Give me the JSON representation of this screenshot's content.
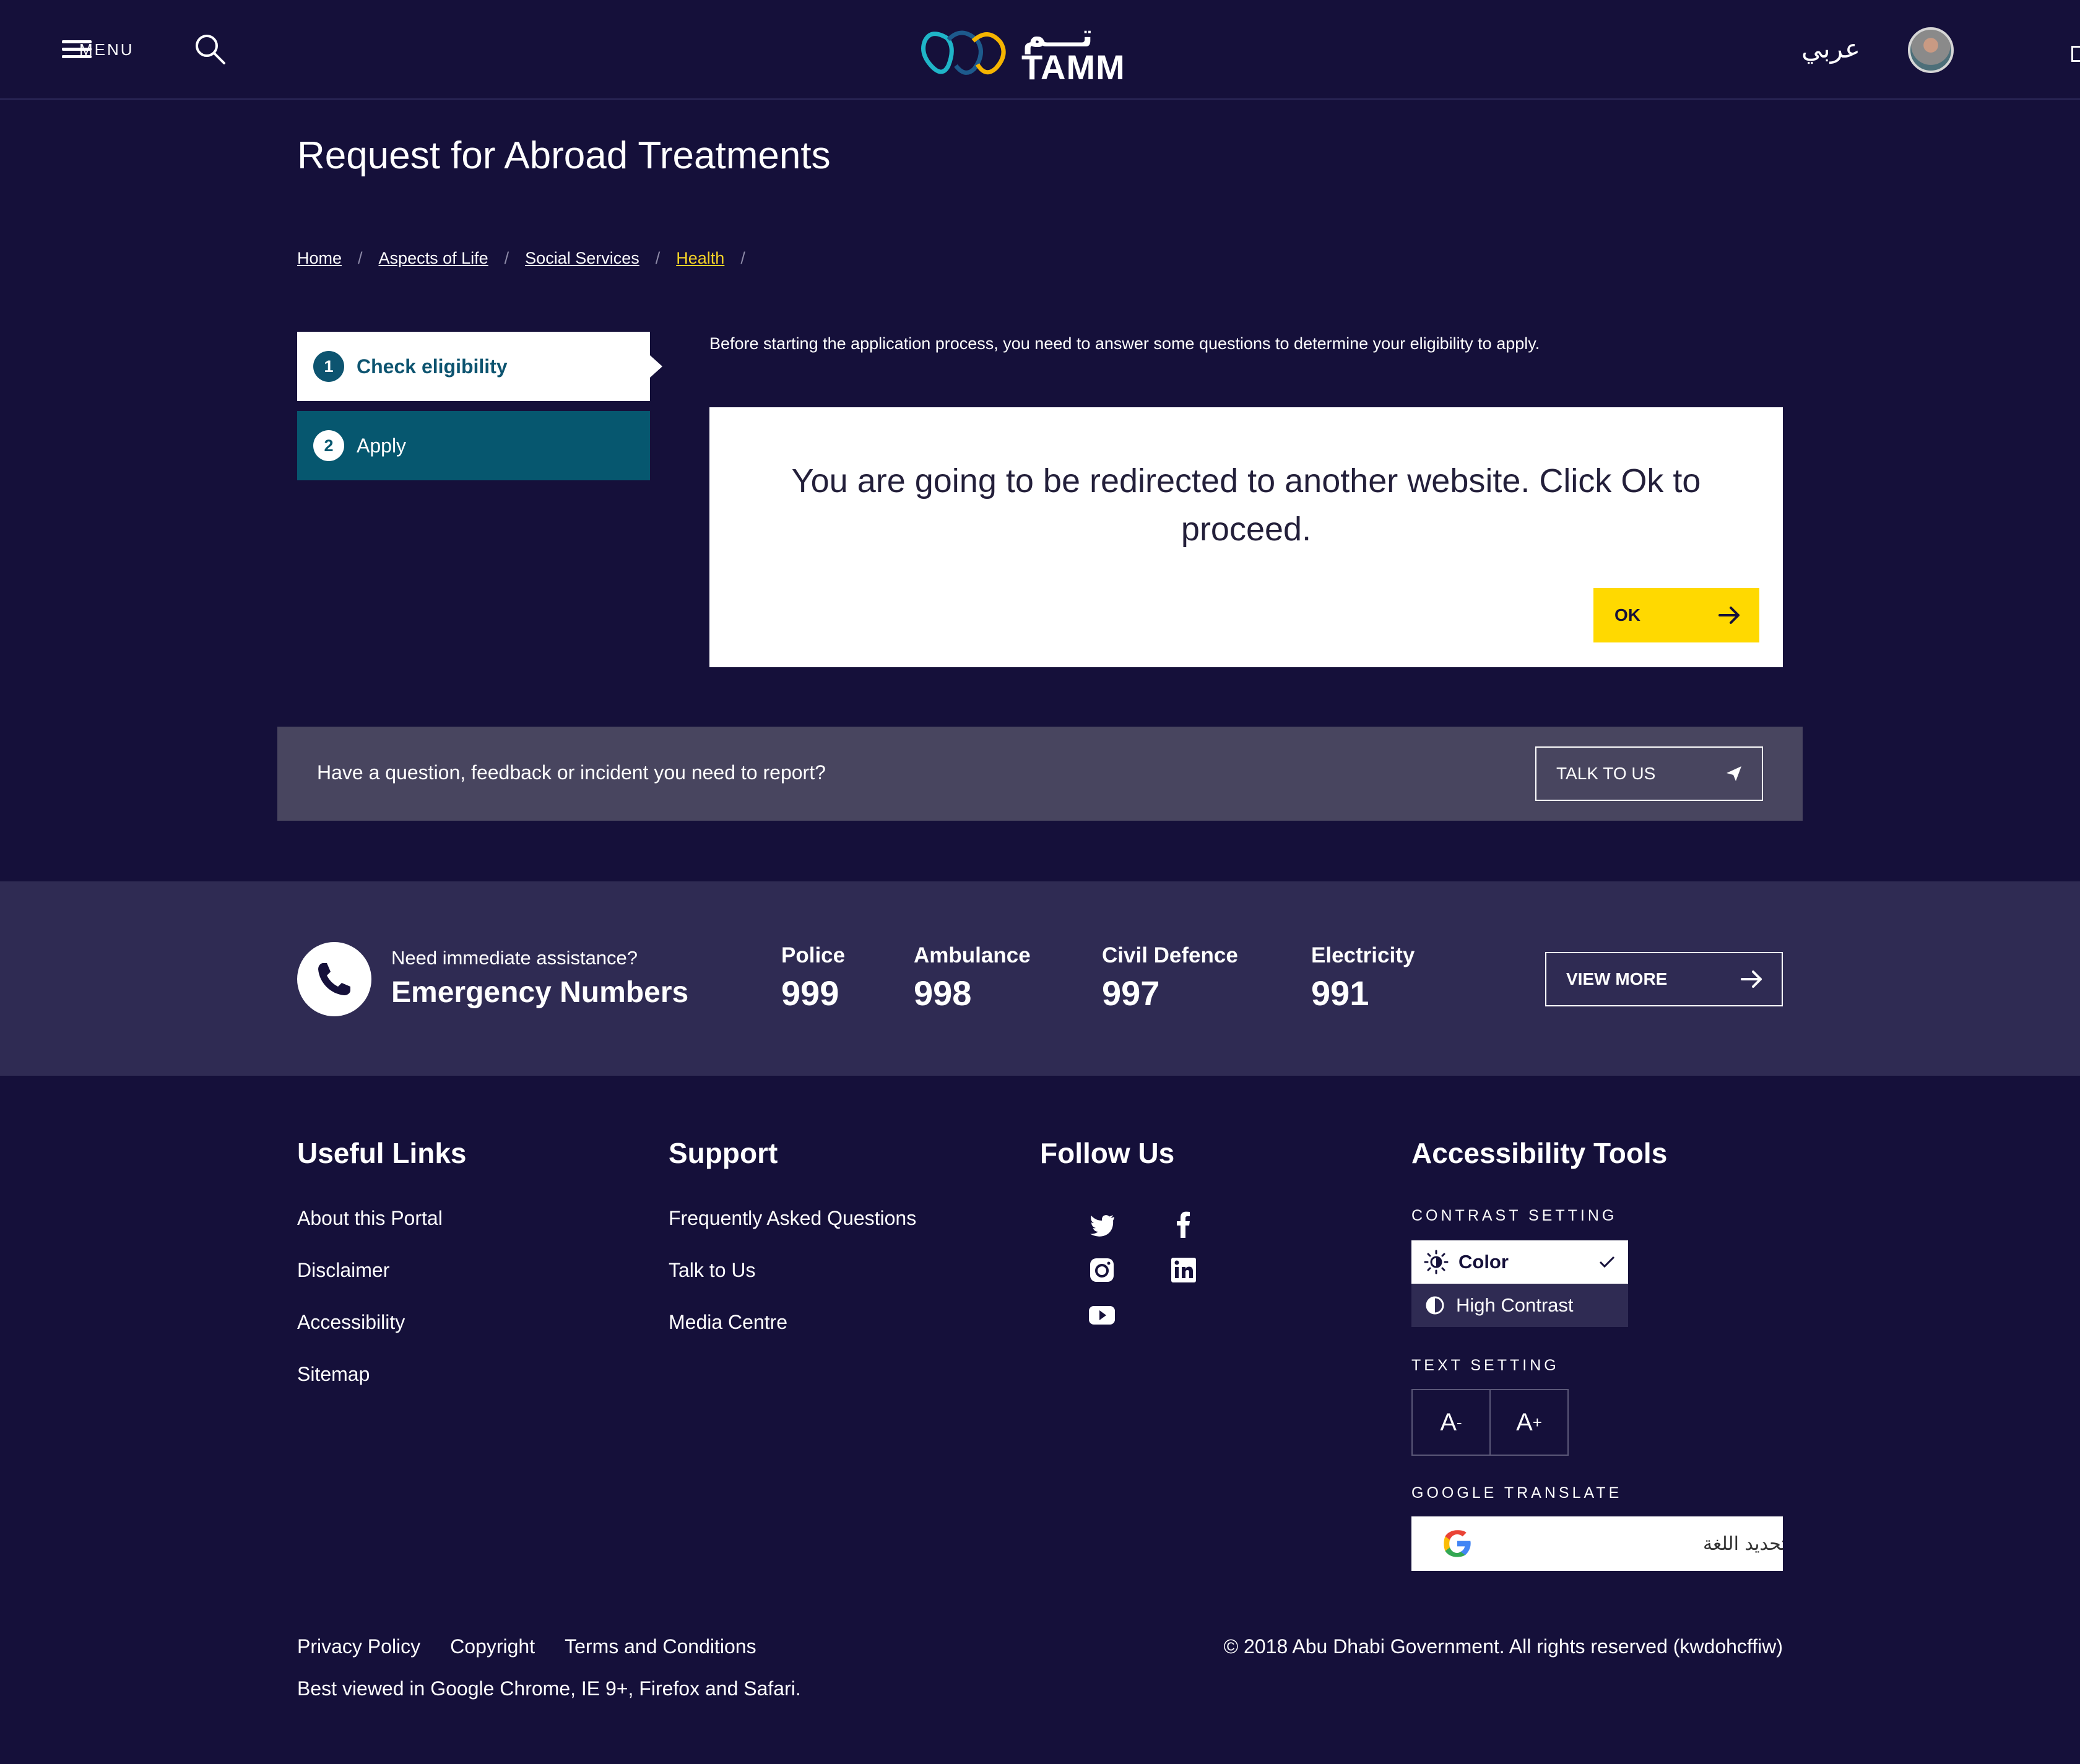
{
  "header": {
    "menu_label": "MENU",
    "brand_name": "TAMM",
    "brand_arabic": "تـــم",
    "language_toggle": "عربي",
    "brand_colors": [
      "#1fb5c8",
      "#f5b400",
      "#1d5a8c"
    ]
  },
  "page": {
    "title": "Request for Abroad Treatments"
  },
  "breadcrumb": {
    "items": [
      "Home",
      "Aspects of Life",
      "Social Services",
      "Health"
    ],
    "separator": "/"
  },
  "steps": [
    {
      "number": "1",
      "label": "Check eligibility",
      "state": "active"
    },
    {
      "number": "2",
      "label": "Apply",
      "state": "inactive"
    }
  ],
  "main": {
    "intro": "Before starting the application process, you need to answer some questions to determine your eligibility to apply.",
    "redirect_message": "You are going to be redirected to another website. Click Ok to proceed.",
    "ok_label": "OK"
  },
  "feedback": {
    "text": "Have a question, feedback or incident you need to report?",
    "button_label": "TALK TO US"
  },
  "emergency": {
    "subtitle": "Need immediate assistance?",
    "title": "Emergency Numbers",
    "numbers": [
      {
        "label": "Police",
        "value": "999"
      },
      {
        "label": "Ambulance",
        "value": "998"
      },
      {
        "label": "Civil Defence",
        "value": "997"
      },
      {
        "label": "Electricity",
        "value": "991"
      }
    ],
    "view_more_label": "VIEW MORE"
  },
  "footer": {
    "useful_links": {
      "title": "Useful Links",
      "items": [
        "About this Portal",
        "Disclaimer",
        "Accessibility",
        "Sitemap"
      ]
    },
    "support": {
      "title": "Support",
      "items": [
        "Frequently Asked Questions",
        "Talk to Us",
        "Media Centre"
      ]
    },
    "follow_us": {
      "title": "Follow Us",
      "icons": [
        "twitter-icon",
        "facebook-icon",
        "instagram-icon",
        "linkedin-icon",
        "youtube-icon"
      ]
    },
    "accessibility": {
      "title": "Accessibility Tools",
      "contrast_label": "CONTRAST SETTING",
      "contrast_options": [
        "Color",
        "High Contrast"
      ],
      "contrast_selected": "Color",
      "text_label": "TEXT SETTING",
      "text_decrease": "A",
      "text_increase": "A",
      "text_decrease_sup": "-",
      "text_increase_sup": "+",
      "translate_label": "GOOGLE TRANSLATE",
      "translate_placeholder": "تحديد اللغة"
    },
    "legal_links": [
      "Privacy Policy",
      "Copyright",
      "Terms and Conditions"
    ],
    "browser_note": "Best viewed in Google Chrome, IE 9+, Firefox and Safari.",
    "copyright": "© 2018 Abu Dhabi Government. All rights reserved (kwdohcffiw)"
  },
  "colors": {
    "background": "#15103a",
    "accent_yellow": "#ffd900",
    "step_teal": "#06576f",
    "panel": "#2f2b53"
  }
}
